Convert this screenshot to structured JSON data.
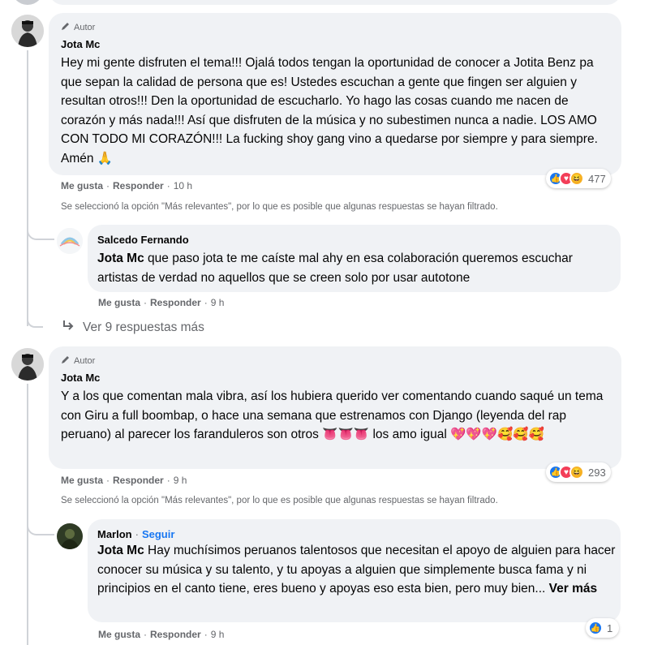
{
  "comments": [
    {
      "author_tag": "Autor",
      "name": "Jota Mc",
      "text": "Hey mi gente disfruten el tema!!! Ojalá todos tengan la oportunidad de conocer a Jotita Benz pa que sepan la calidad de persona que es! Ustedes escuchan a gente que fingen ser alguien y resultan otros!!! Den la oportunidad de escucharlo. Yo hago las cosas cuando me nacen de corazón y más nada!!! Así que disfruten de la música y no subestimen nunca a nadie. LOS AMO CON TODO MI CORAZÓN!!! La fucking shoy gang vino a quedarse por siempre y para siempre. Amén 🙏",
      "like_label": "Me gusta",
      "reply_label": "Responder",
      "time": "10 h",
      "reaction_count": "477",
      "filter_note": "Se seleccionó la opción \"Más relevantes\", por lo que es posible que algunas respuestas se hayan filtrado.",
      "more_replies": "Ver 9 respuestas más"
    },
    {
      "author_tag": "Autor",
      "name": "Jota Mc",
      "text": "Y a los que comentan mala vibra, así los hubiera querido ver comentando cuando saqué un tema con Giru a full boombap, o hace una semana que estrenamos con Django (leyenda del rap peruano) al parecer los faranduleros son otros 👅👅👅 los amo igual 💖💖💖🥰🥰🥰",
      "like_label": "Me gusta",
      "reply_label": "Responder",
      "time": "9 h",
      "reaction_count": "293",
      "filter_note": "Se seleccionó la opción \"Más relevantes\", por lo que es posible que algunas respuestas se hayan filtrado."
    }
  ],
  "replies": [
    {
      "name": "Salcedo Fernando",
      "mention": "Jota Mc",
      "text": " que paso jota te me caíste mal ahy en esa colaboración queremos escuchar artistas de verdad no aquellos que se creen solo por usar autotone",
      "like_label": "Me gusta",
      "reply_label": "Responder",
      "time": "9 h"
    },
    {
      "name": "Marlon",
      "follow_label": "Seguir",
      "mention": "Jota Mc",
      "text": " Hay muchísimos peruanos talentosos que necesitan el apoyo de alguien para hacer conocer su música y su talento, y tu apoyas a alguien que simplemente busca fama y ni principios en el canto tiene, eres bueno y apoyas eso esta bien, pero muy bien...",
      "see_more": "Ver más",
      "like_label": "Me gusta",
      "reply_label": "Responder",
      "time": "9 h",
      "reaction_count": "1"
    }
  ],
  "separator": "·",
  "colors": {
    "like": "#1877f2",
    "love": "#f33e58",
    "haha": "#f7b125",
    "bubble": "#f0f2f5"
  },
  "icons": [
    "pencil-icon",
    "like-reaction-icon",
    "love-reaction-icon",
    "haha-reaction-icon",
    "reply-arrow-icon"
  ]
}
